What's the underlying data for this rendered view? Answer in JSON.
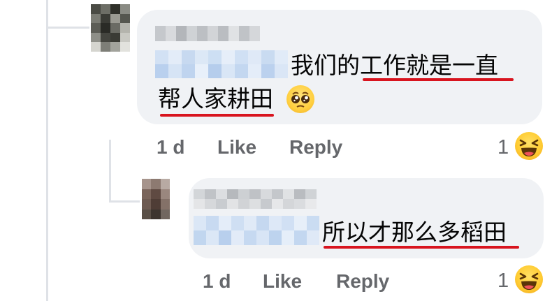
{
  "comments": [
    {
      "text_main": "我们的工作就是一直",
      "text_second": "帮人家耕田",
      "text_emoji": "pleading-face-emoji",
      "time": "1 d",
      "like_label": "Like",
      "reply_label": "Reply",
      "reaction_count": "1",
      "reaction_icon": "laughing-face-emoji"
    },
    {
      "text_main": "所以才那么多稻田",
      "time": "1 d",
      "like_label": "Like",
      "reply_label": "Reply",
      "reaction_count": "1",
      "reaction_icon": "laughing-face-emoji"
    }
  ],
  "colors": {
    "bubble": "#f0f2f5",
    "meta_text": "#65676b",
    "underline": "#d8141e",
    "thread_line": "#dfe2e7"
  }
}
